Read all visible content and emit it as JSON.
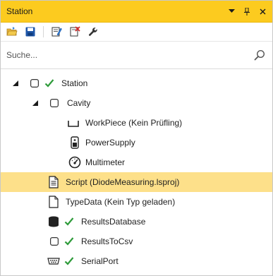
{
  "window": {
    "title": "Station"
  },
  "search": {
    "placeholder": "Suche..."
  },
  "tree": {
    "items": [
      {
        "label": "Station"
      },
      {
        "label": "Cavity"
      },
      {
        "label": "WorkPiece (Kein Prüfling)"
      },
      {
        "label": "PowerSupply"
      },
      {
        "label": "Multimeter"
      },
      {
        "label": "Script (DiodeMeasuring.lsproj)",
        "selected": true
      },
      {
        "label": "TypeData (Kein Typ geladen)"
      },
      {
        "label": "ResultsDatabase"
      },
      {
        "label": "ResultsToCsv"
      },
      {
        "label": "SerialPort"
      }
    ]
  },
  "colors": {
    "titlebar": "#fccb1f",
    "selection": "#fde08a",
    "check": "#2e9b3a"
  }
}
